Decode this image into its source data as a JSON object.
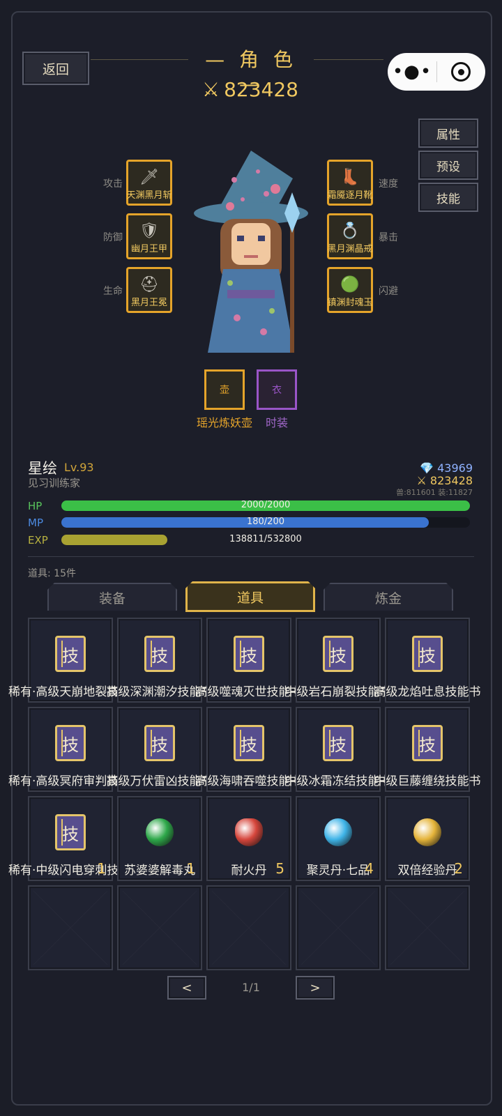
{
  "header": {
    "back_label": "返回",
    "title": "— 角 色 —",
    "power": "823428"
  },
  "side_buttons": [
    "属性",
    "预设",
    "技能"
  ],
  "equipment": {
    "left": [
      {
        "label": "攻击",
        "name": "天渊黑月斩",
        "icon": "sword-icon"
      },
      {
        "label": "防御",
        "name": "幽月王甲",
        "icon": "armor-icon"
      },
      {
        "label": "生命",
        "name": "黑月王冕",
        "icon": "helmet-icon"
      }
    ],
    "right": [
      {
        "label": "速度",
        "name": "霜魇逐月靴",
        "icon": "boots-icon"
      },
      {
        "label": "暴击",
        "name": "黑月渊晶戒",
        "icon": "ring-icon"
      },
      {
        "label": "闪避",
        "name": "镇渊封魂玉",
        "icon": "jade-icon"
      }
    ],
    "bottom": [
      {
        "slot": "壶",
        "label": "瑶光炼妖壶",
        "color": "#e5a42a"
      },
      {
        "slot": "衣",
        "label": "时装",
        "color": "#9a55c8"
      }
    ]
  },
  "character": {
    "name": "星绘",
    "level": "Lv.93",
    "title": "见习训练家",
    "gems": "43969",
    "power": "823428",
    "split": "兽:811601 装:11827"
  },
  "bars": [
    {
      "label": "HP",
      "value": "2000/2000",
      "fraction": 1.0,
      "color": "#3bbf47",
      "label_color": "#58c45c"
    },
    {
      "label": "MP",
      "value": "180/200",
      "fraction": 0.9,
      "color": "#3a73cf",
      "label_color": "#4c8ae0"
    },
    {
      "label": "EXP",
      "value": "138811/532800",
      "fraction": 0.26,
      "color": "#a8a232",
      "label_color": "#b8b240"
    }
  ],
  "inventory": {
    "count_label": "道具: 15件",
    "tabs": [
      "装备",
      "道具",
      "炼金"
    ],
    "active_tab": 1,
    "items": [
      {
        "type": "book",
        "name": "稀有·高级天崩地裂技能书",
        "qty": ""
      },
      {
        "type": "book",
        "name": "高级深渊潮汐技能书",
        "qty": ""
      },
      {
        "type": "book",
        "name": "高级噬魂灭世技能书",
        "qty": ""
      },
      {
        "type": "book",
        "name": "中级岩石崩裂技能书",
        "qty": ""
      },
      {
        "type": "book",
        "name": "高级龙焰吐息技能书",
        "qty": ""
      },
      {
        "type": "book",
        "name": "稀有·高级冥府审判技能书",
        "qty": ""
      },
      {
        "type": "book",
        "name": "高级万伏雷凶技能书",
        "qty": ""
      },
      {
        "type": "book",
        "name": "高级海啸吞噬技能书",
        "qty": ""
      },
      {
        "type": "book",
        "name": "中级冰霜冻结技能书",
        "qty": ""
      },
      {
        "type": "book",
        "name": "中级巨藤缠绕技能书",
        "qty": ""
      },
      {
        "type": "book",
        "name": "稀有·中级闪电穿刺技能书",
        "qty": "1"
      },
      {
        "type": "orb",
        "name": "苏婆婆解毒丸",
        "qty": "1",
        "color": "#2ea84a"
      },
      {
        "type": "potion",
        "name": "耐火丹",
        "qty": "5",
        "color": "#d6463c"
      },
      {
        "type": "orb",
        "name": "聚灵丹·七品",
        "qty": "4",
        "color": "#3fb4e8"
      },
      {
        "type": "coin",
        "name": "双倍经验丹",
        "qty": "2",
        "color": "#e5b43a"
      }
    ],
    "empty_slots": 5,
    "book_glyph": "技"
  },
  "pager": {
    "prev": "<",
    "next": ">",
    "page": "1/1"
  }
}
